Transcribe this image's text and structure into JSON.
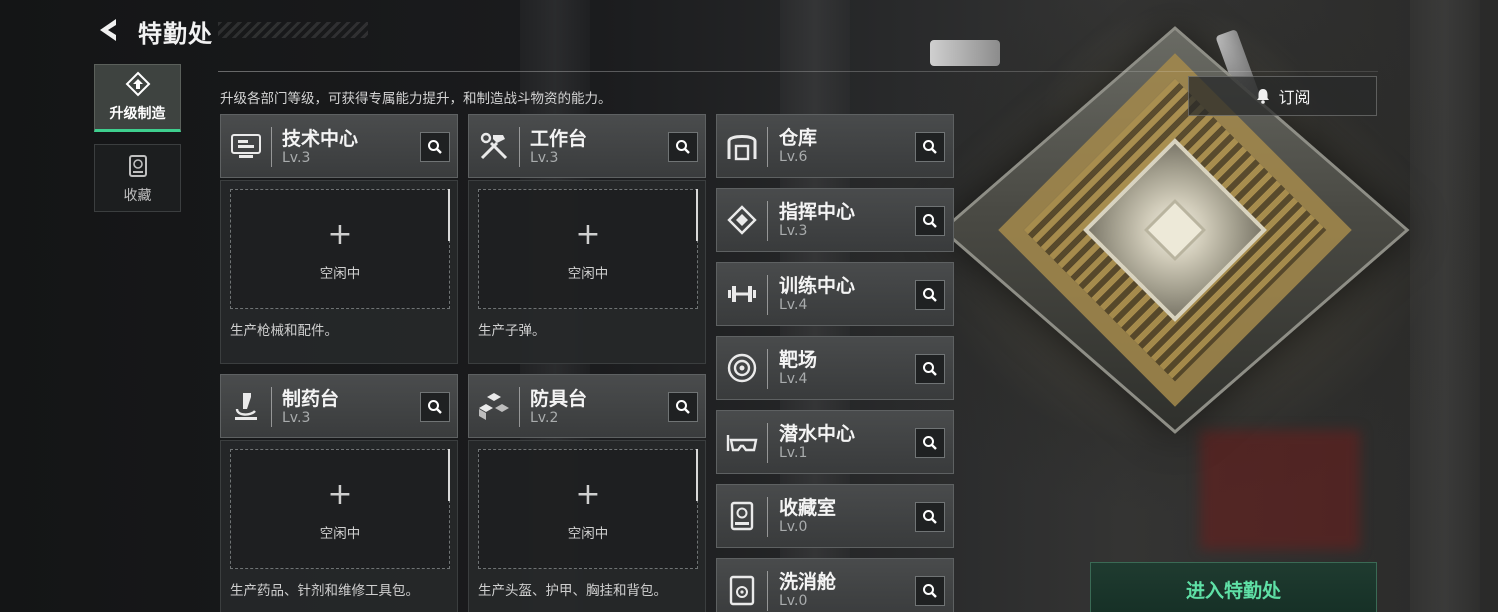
{
  "header": {
    "title": "特勤处"
  },
  "nav": [
    {
      "label": "升级制造",
      "icon": "upgrade-icon",
      "active": true
    },
    {
      "label": "收藏",
      "icon": "collection-icon",
      "active": false
    }
  ],
  "description": "升级各部门等级，可获得专属能力提升，和制造战斗物资的能力。",
  "subscribe_label": "订阅",
  "workstations": [
    {
      "name": "技术中心",
      "level": "Lv.3",
      "icon": "tech-center-icon",
      "slot_plus": "+",
      "slot_status": "空闲中",
      "desc": "生产枪械和配件。"
    },
    {
      "name": "工作台",
      "level": "Lv.3",
      "icon": "workbench-tools-icon",
      "slot_plus": "+",
      "slot_status": "空闲中",
      "desc": "生产子弹。"
    },
    {
      "name": "制药台",
      "level": "Lv.3",
      "icon": "microscope-icon",
      "slot_plus": "+",
      "slot_status": "空闲中",
      "desc": "生产药品、针剂和维修工具包。"
    },
    {
      "name": "防具台",
      "level": "Lv.2",
      "icon": "armor-blocks-icon",
      "slot_plus": "+",
      "slot_status": "空闲中",
      "desc": "生产头盔、护甲、胸挂和背包。"
    }
  ],
  "facilities": [
    {
      "name": "仓库",
      "level": "Lv.6",
      "icon": "warehouse-icon"
    },
    {
      "name": "指挥中心",
      "level": "Lv.3",
      "icon": "chip-icon"
    },
    {
      "name": "训练中心",
      "level": "Lv.4",
      "icon": "dumbbell-icon"
    },
    {
      "name": "靶场",
      "level": "Lv.4",
      "icon": "target-icon"
    },
    {
      "name": "潜水中心",
      "level": "Lv.1",
      "icon": "diving-mask-icon"
    },
    {
      "name": "收藏室",
      "level": "Lv.0",
      "icon": "display-case-icon"
    },
    {
      "name": "洗消舱",
      "level": "Lv.0",
      "icon": "radiation-chamber-icon"
    }
  ],
  "enter_button": "进入特勤处",
  "colors": {
    "accent": "#3ecf8e",
    "enter_text": "#5fe0a6",
    "card": "#3e4041"
  }
}
